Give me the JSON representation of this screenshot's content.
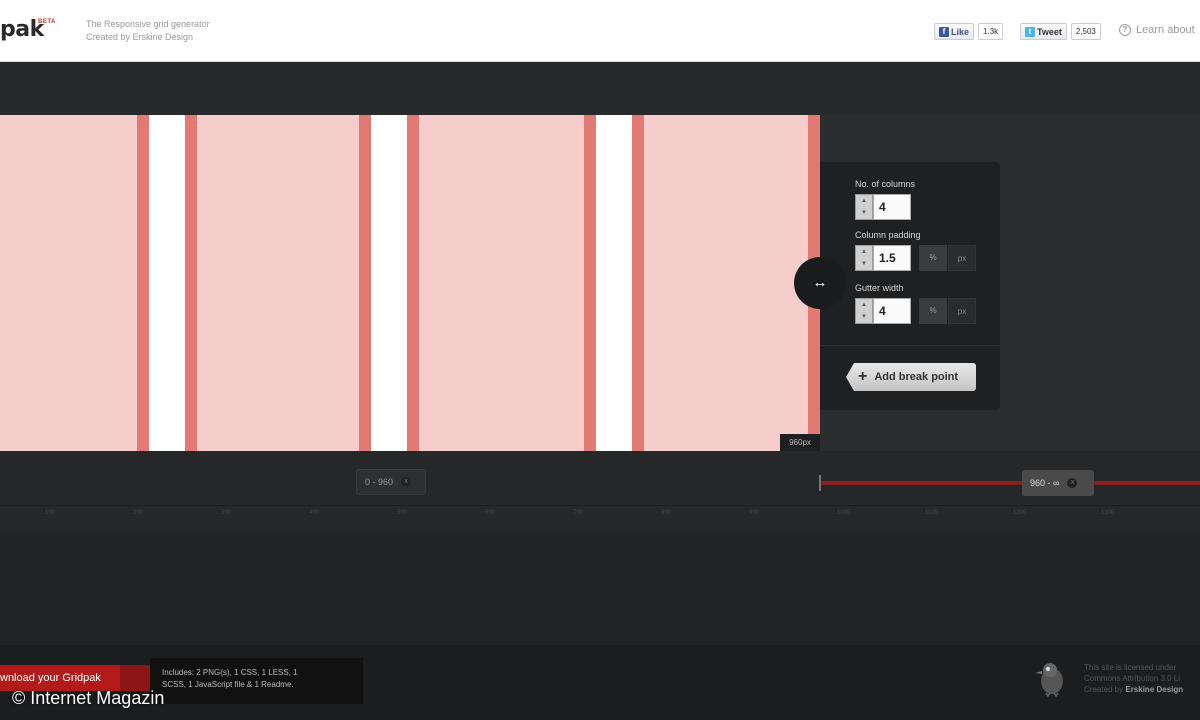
{
  "header": {
    "logo": "pak",
    "beta": "BETA",
    "tagline": "The Responsive grid generator",
    "credit": "Created by Erskine Design",
    "facebook": {
      "label": "Like",
      "count": "1.3k"
    },
    "twitter": {
      "label": "Tweet",
      "count": "2,503"
    },
    "learn": "Learn about"
  },
  "grid": {
    "width_label": "960px"
  },
  "settings": {
    "columns_label": "No. of columns",
    "columns_value": "4",
    "padding_label": "Column padding",
    "padding_value": "1.5",
    "gutter_label": "Gutter width",
    "gutter_value": "4",
    "unit_percent": "%",
    "unit_px": "px",
    "add_breakpoint": "Add break point",
    "resize_icon": "↔"
  },
  "breakpoints": {
    "first": "0 - 960",
    "second": "960 - ∞",
    "remove_icon": "x",
    "ruler_ticks": [
      "100",
      "200",
      "300",
      "400",
      "500",
      "600",
      "700",
      "800",
      "900",
      "1000",
      "1100",
      "1200",
      "1300"
    ]
  },
  "footer": {
    "download": "wnload your Gridpak",
    "includes_line1": "Includes: 2 PNG(s), 1 CSS, 1 LESS, 1",
    "includes_line2": "SCSS, 1 JavaScript file & 1 Readme.",
    "watermark": "© Internet Magazin",
    "license_line1": "This site is licensed under",
    "license_line2": "Commons Attribution 3.0 Li",
    "license_line3_prefix": "Created by ",
    "license_line3_name": "Erskine Design"
  }
}
